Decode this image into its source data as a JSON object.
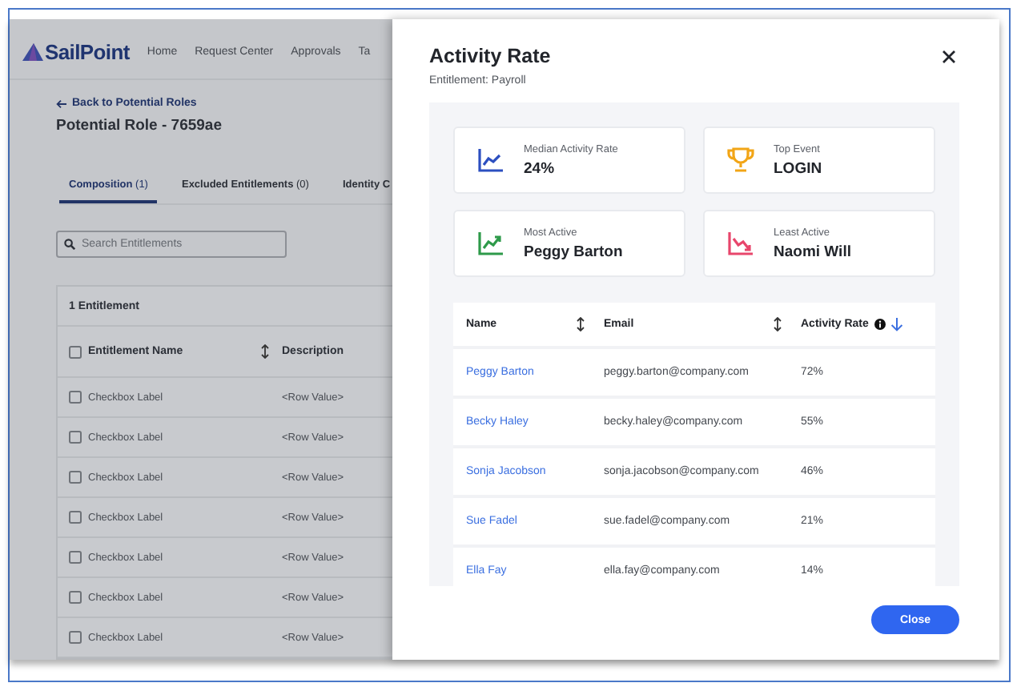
{
  "app": {
    "logo": "SailPoint",
    "nav": [
      "Home",
      "Request Center",
      "Approvals",
      "Ta"
    ],
    "back_link": "Back to Potential Roles",
    "title": "Potential Role - 7659ae",
    "tabs": [
      {
        "label": "Composition",
        "count": "(1)",
        "selected": true
      },
      {
        "label": "Excluded Entitlements",
        "count": "(0)",
        "selected": false
      },
      {
        "label": "Identity C",
        "selected": false
      }
    ],
    "search": {
      "placeholder": "Search Entitlements"
    },
    "table": {
      "caption": "1 Entitlement",
      "select_all_checked": false,
      "columns": [
        "Entitlement Name",
        "Description"
      ],
      "rows": [
        {
          "name": "Checkbox Label",
          "description": "<Row Value>",
          "checked": false
        },
        {
          "name": "Checkbox Label",
          "description": "<Row Value>",
          "checked": false
        },
        {
          "name": "Checkbox Label",
          "description": "<Row Value>",
          "checked": false
        },
        {
          "name": "Checkbox Label",
          "description": "<Row Value>",
          "checked": false
        },
        {
          "name": "Checkbox Label",
          "description": "<Row Value>",
          "checked": false
        },
        {
          "name": "Checkbox Label",
          "description": "<Row Value>",
          "checked": false
        },
        {
          "name": "Checkbox Label",
          "description": "<Row Value>",
          "checked": false
        }
      ]
    }
  },
  "modal": {
    "title": "Activity Rate",
    "subtitle": "Entitlement: Payroll",
    "stats": [
      {
        "kind": "median",
        "label": "Median Activity Rate",
        "value": "24%"
      },
      {
        "kind": "top",
        "label": "Top Event",
        "value": "LOGIN"
      },
      {
        "kind": "most",
        "label": "Most Active",
        "value": "Peggy Barton"
      },
      {
        "kind": "least",
        "label": "Least Active",
        "value": "Naomi Will"
      }
    ],
    "table": {
      "columns": [
        {
          "label": "Name",
          "sorted": false
        },
        {
          "label": "Email",
          "sorted": false
        },
        {
          "label": "Activity Rate",
          "info": true,
          "sorted": true
        }
      ],
      "rows": [
        {
          "name": "Peggy Barton",
          "email": "peggy.barton@company.com",
          "rate": "72%"
        },
        {
          "name": "Becky Haley",
          "email": "becky.haley@company.com",
          "rate": "55%"
        },
        {
          "name": "Sonja Jacobson",
          "email": "sonja.jacobson@company.com",
          "rate": "46%"
        },
        {
          "name": "Sue Fadel",
          "email": "sue.fadel@company.com",
          "rate": "21%"
        },
        {
          "name": "Ella Fay",
          "email": "ella.fay@company.com",
          "rate": "14%"
        }
      ]
    },
    "close_button": "Close"
  }
}
